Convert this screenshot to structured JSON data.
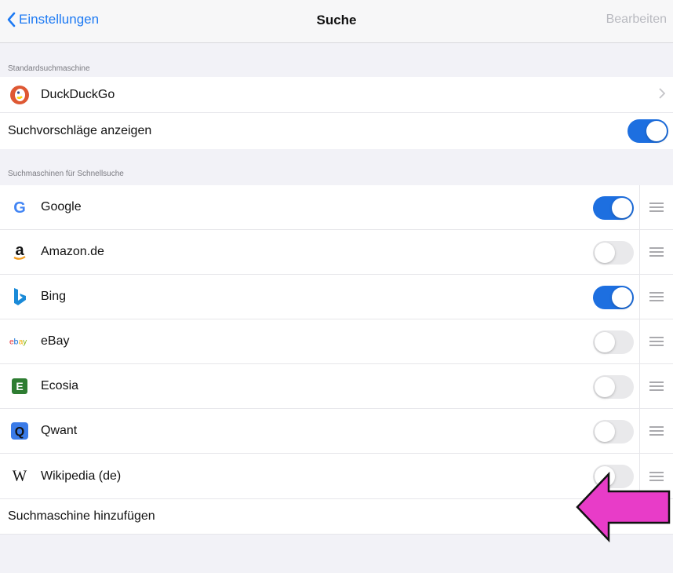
{
  "navbar": {
    "back_label": "Einstellungen",
    "title": "Suche",
    "edit_label": "Bearbeiten"
  },
  "default_section": {
    "header": "Standardsuchmaschine",
    "engine_name": "DuckDuckGo",
    "suggestions_label": "Suchvorschläge anzeigen",
    "suggestions_on": true
  },
  "quick_section": {
    "header": "Suchmaschinen für Schnellsuche",
    "engines": [
      {
        "name": "Google",
        "enabled": true,
        "icon": "google-icon"
      },
      {
        "name": "Amazon.de",
        "enabled": false,
        "icon": "amazon-icon"
      },
      {
        "name": "Bing",
        "enabled": true,
        "icon": "bing-icon"
      },
      {
        "name": "eBay",
        "enabled": false,
        "icon": "ebay-icon"
      },
      {
        "name": "Ecosia",
        "enabled": false,
        "icon": "ecosia-icon"
      },
      {
        "name": "Qwant",
        "enabled": false,
        "icon": "qwant-icon"
      },
      {
        "name": "Wikipedia (de)",
        "enabled": false,
        "icon": "wikipedia-icon"
      }
    ]
  },
  "add_engine_label": "Suchmaschine hinzufügen",
  "colors": {
    "accent": "#1d7af3",
    "toggle_on": "#1d6fe0",
    "arrow": "#e83cc8"
  }
}
